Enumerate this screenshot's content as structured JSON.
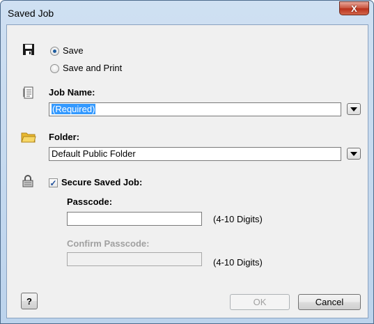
{
  "window": {
    "title": "Saved Job",
    "close_glyph": "X"
  },
  "mode": {
    "options": [
      {
        "label": "Save",
        "selected": true
      },
      {
        "label": "Save and Print",
        "selected": false
      }
    ]
  },
  "job_name": {
    "label": "Job Name:",
    "value": "(Required)"
  },
  "folder": {
    "label": "Folder:",
    "value": "Default Public Folder"
  },
  "secure": {
    "label": "Secure Saved Job:",
    "checked": true,
    "check_glyph": "✓",
    "passcode": {
      "label": "Passcode:",
      "value": "",
      "hint": "(4-10 Digits)"
    },
    "confirm": {
      "label": "Confirm Passcode:",
      "value": "",
      "hint": "(4-10 Digits)"
    }
  },
  "buttons": {
    "help": "?",
    "ok": "OK",
    "cancel": "Cancel"
  },
  "colors": {
    "accent": "#3399ff",
    "titlebar": "#bcd3ec",
    "close": "#c7503a"
  },
  "icons": [
    "floppy-disk-icon",
    "job-name-icon",
    "folder-icon",
    "lock-icon"
  ]
}
